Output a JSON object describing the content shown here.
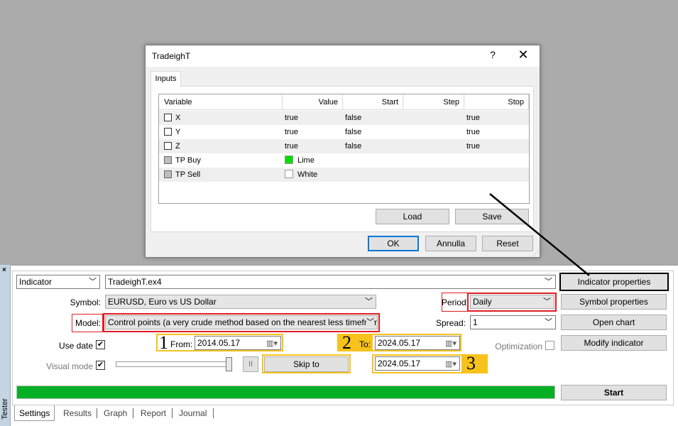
{
  "dialog": {
    "title": "TradeighT",
    "help_label": "?",
    "close_label": "✕",
    "tab_label": "Inputs",
    "columns": [
      "Variable",
      "Value",
      "Start",
      "Step",
      "Stop"
    ],
    "rows": [
      {
        "variable": "X",
        "value": "true",
        "start": "false",
        "step": "",
        "stop": "true"
      },
      {
        "variable": "Y",
        "value": "true",
        "start": "false",
        "step": "",
        "stop": "true"
      },
      {
        "variable": "Z",
        "value": "true",
        "start": "false",
        "step": "",
        "stop": "true"
      },
      {
        "variable": "TP Buy",
        "value": "Lime",
        "swatch": "#00dd00"
      },
      {
        "variable": "TP Sell",
        "value": "White",
        "swatch": "#ffffff"
      }
    ],
    "load_label": "Load",
    "save_label": "Save",
    "ok_label": "OK",
    "cancel_label": "Annulla",
    "reset_label": "Reset"
  },
  "tester": {
    "side_label": "Tester",
    "close_label": "×",
    "type_value": "Indicator",
    "file_value": "TradeighT.ex4",
    "symbol_label": "Symbol:",
    "symbol_value": "EURUSD, Euro vs US Dollar",
    "period_label": "Period:",
    "period_value": "Daily",
    "model_label": "Model:",
    "model_value": "Control points (a very crude method based on the nearest less timeframe, the",
    "spread_label": "Spread:",
    "spread_value": "1",
    "use_date_label": "Use date",
    "from_label": "From:",
    "from_value": "2014.05.17",
    "to_label": "To:",
    "to_value": "2024.05.17",
    "optimization_label": "Optimization",
    "visual_mode_label": "Visual mode",
    "pause_label": "II",
    "skip_to_label": "Skip to",
    "skip_date_value": "2024.05.17",
    "annot_1": "1",
    "annot_2": "2",
    "annot_3": "3",
    "btn_indicator_properties": "Indicator properties",
    "btn_symbol_properties": "Symbol properties",
    "btn_open_chart": "Open chart",
    "btn_modify_indicator": "Modify indicator",
    "btn_start": "Start",
    "progress_fraction": 1.0,
    "tabs": [
      "Settings",
      "Results",
      "Graph",
      "Report",
      "Journal"
    ]
  },
  "colors": {
    "highlight_red": "#e01e25",
    "highlight_yellow": "#f7c21c",
    "progress_green": "#06b025"
  }
}
